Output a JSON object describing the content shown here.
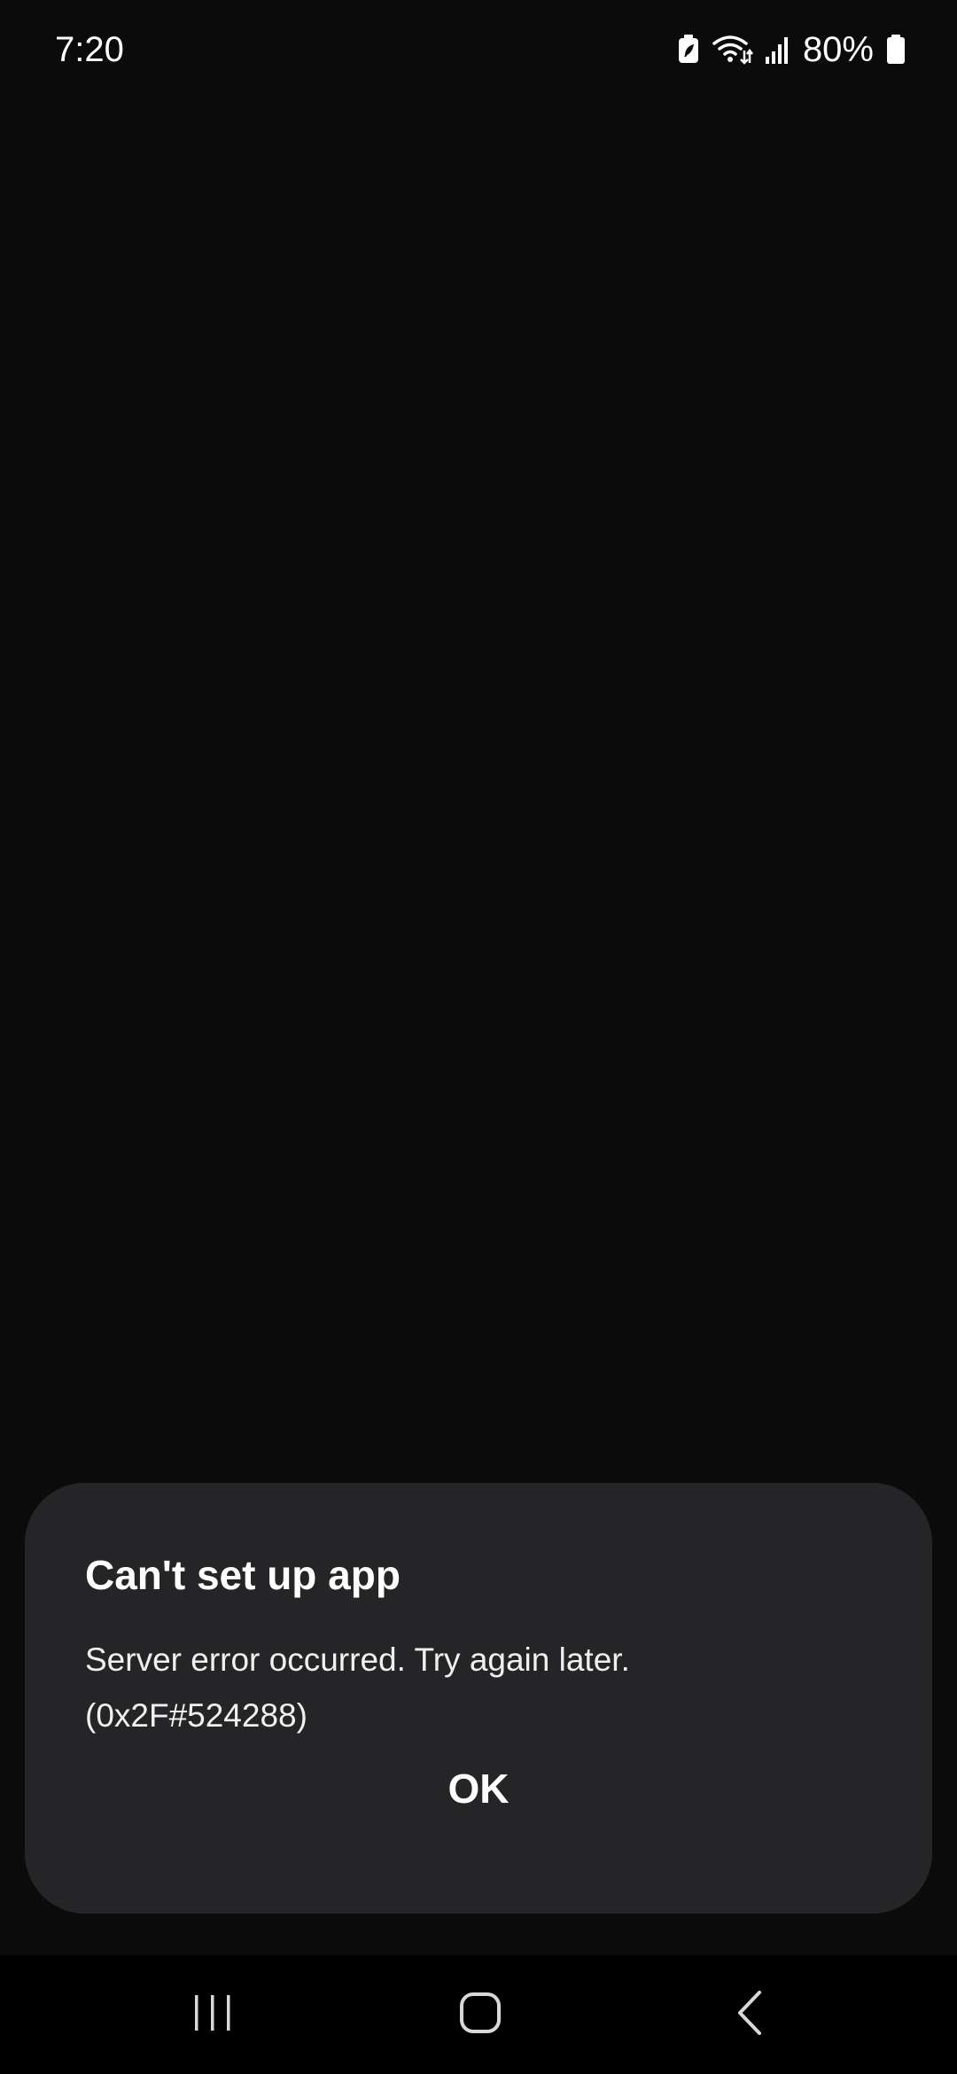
{
  "status_bar": {
    "time": "7:20",
    "battery_percent": "80%",
    "icons": [
      "battery-saver-icon",
      "wifi-icon",
      "signal-icon",
      "battery-icon"
    ]
  },
  "dialog": {
    "title": "Can't set up app",
    "message_line1": "Server error occurred. Try again later.",
    "message_line2": "(0x2F#524288)",
    "ok_label": "OK"
  },
  "nav_bar": {
    "buttons": [
      "recents-icon",
      "home-icon",
      "back-icon"
    ]
  },
  "colors": {
    "background": "#0b0b0b",
    "dialog": "#252527",
    "nav_bar": "#000000",
    "text": "#ffffff"
  }
}
